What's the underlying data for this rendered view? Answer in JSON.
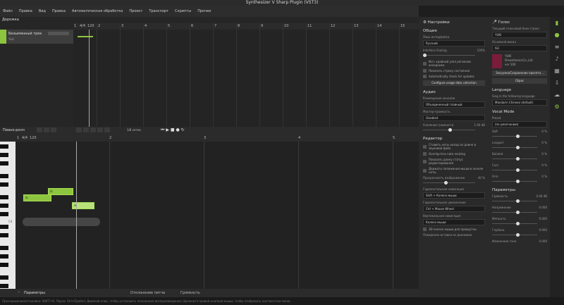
{
  "window": {
    "title": "Synthesizer V Sharp Plugin (VST3)"
  },
  "menu": [
    "Файл",
    "Правка",
    "Вид",
    "Правка",
    "Автоматическая обработка",
    "Проект",
    "Транспорт",
    "Скрипты",
    "Прочее"
  ],
  "tracks": {
    "header": "Дорожка",
    "items": [
      {
        "name": "Безымянный трек",
        "sub": "Yuki"
      }
    ]
  },
  "arrangement": {
    "ruler": [
      "1",
      "4/4",
      "120",
      "2",
      "3",
      "4",
      "5",
      "6",
      "7",
      "8",
      "9",
      "10",
      "11",
      "12",
      "13",
      "14",
      "15"
    ]
  },
  "piano": {
    "header": "Пиано-ролл",
    "snap": "1/8 сетка",
    "ruler_start": [
      "1",
      "4/4",
      "120"
    ],
    "bars": [
      "2",
      "3",
      "4",
      "5"
    ],
    "notes": [
      {
        "label": "la",
        "lyric": "la"
      },
      {
        "label": "la",
        "lyric": "la"
      },
      {
        "label": "la",
        "lyric": "la"
      }
    ],
    "key_label": "C4"
  },
  "params_bar": {
    "label": "Параметры",
    "hint1": "Отклонение питча",
    "hint2": "Громкость"
  },
  "status": "Проигрывание/остановка: SHIFT+R; Пауза: Ctrl+Пробел; Двойной клик, чтобы установить положение воспроизведения; Щелкните правой кнопкой мыши, чтобы отобразить контекстное меню.",
  "settings": {
    "title": "Настройки",
    "general": {
      "title": "Общие",
      "lang_label": "Язык интерфейса",
      "lang_value": "Русский",
      "scaling_label": "Interface Scaling",
      "scaling_value": "100%",
      "checks": [
        "Исп. крайний узел регионов исходника",
        "Показать строку состояния",
        "Automatically check for updates"
      ],
      "usage_btn": "Configure usage data collection"
    },
    "audio": {
      "title": "Аудио",
      "channels_label": "Размещение каналов",
      "channels_value": "Объединенный главный",
      "mixer_label": "Мастер-громкость",
      "mixer_value": "Glasbled",
      "gain_label": "Усиление громкости",
      "gain_value": "1.00 dB"
    },
    "editor": {
      "title": "Редактор",
      "checks": [
        "Ставить ноты назад по длине в звуковой файл",
        "Overlap-less note resizing",
        "Показать длину статус редактирования",
        "Держать положения мыши в начале ноты"
      ],
      "transparency_label": "Прозрачность изображения",
      "transparency_value": "40 %",
      "hnav_label": "Горизонтальная навигация",
      "hnav_value": "Shift + Колесо мыши",
      "hzoom_label": "Горизонтальное увеличение",
      "hzoom_value": "Ctrl + Mouse Wheel",
      "vnav_label": "Вертикальная навигация",
      "vnav_value": "Колесо мыши",
      "check_last": "3D колесо мыши для прокрутки",
      "wheel_label": "Поведение вставки из динамики",
      "rev": "REV"
    }
  },
  "voice": {
    "title": "Голос",
    "db_label": "Текущий голосовой банк (трек)",
    "db_value": "YUKI",
    "lang_label": "Основной вокал",
    "lang_value": "ISC",
    "card": {
      "name": "YUKI",
      "vendor": "DreamtonicsCo.,Ltd.",
      "version": "ver 100"
    },
    "btn1": "Загрузка/Сохранение пресета…",
    "btn2": "Сброс",
    "language": {
      "title": "Language",
      "sing_label": "Sing in the following language",
      "sing_value": "Mandarin Chinese (default)"
    },
    "vocal_mode": {
      "title": "Vocal Mode",
      "preset_label": "Preset",
      "preset_value": "(по умолчанию)",
      "modes": [
        {
          "name": "Soft",
          "val": "0 %"
        },
        {
          "name": "Languid",
          "val": "0 %"
        },
        {
          "name": "Belated",
          "val": "0 %"
        },
        {
          "name": "Cool",
          "val": "0 %"
        },
        {
          "name": "Firm",
          "val": "0 %"
        }
      ]
    },
    "params": {
      "title": "Параметры",
      "items": [
        {
          "name": "Громкость",
          "val": "0.00 dB"
        },
        {
          "name": "Напряжение",
          "val": "0.000"
        },
        {
          "name": "Мягкость",
          "val": "0.000"
        },
        {
          "name": "Глубина",
          "val": "0.000"
        },
        {
          "name": "Изменение тона",
          "val": "0.000"
        }
      ]
    }
  },
  "icons": [
    "wave-icon",
    "mic-icon",
    "sliders-icon",
    "note-icon",
    "grid-icon",
    "export-icon",
    "cloud-icon",
    "gear-icon"
  ],
  "colors": {
    "accent": "#8dc53f"
  }
}
